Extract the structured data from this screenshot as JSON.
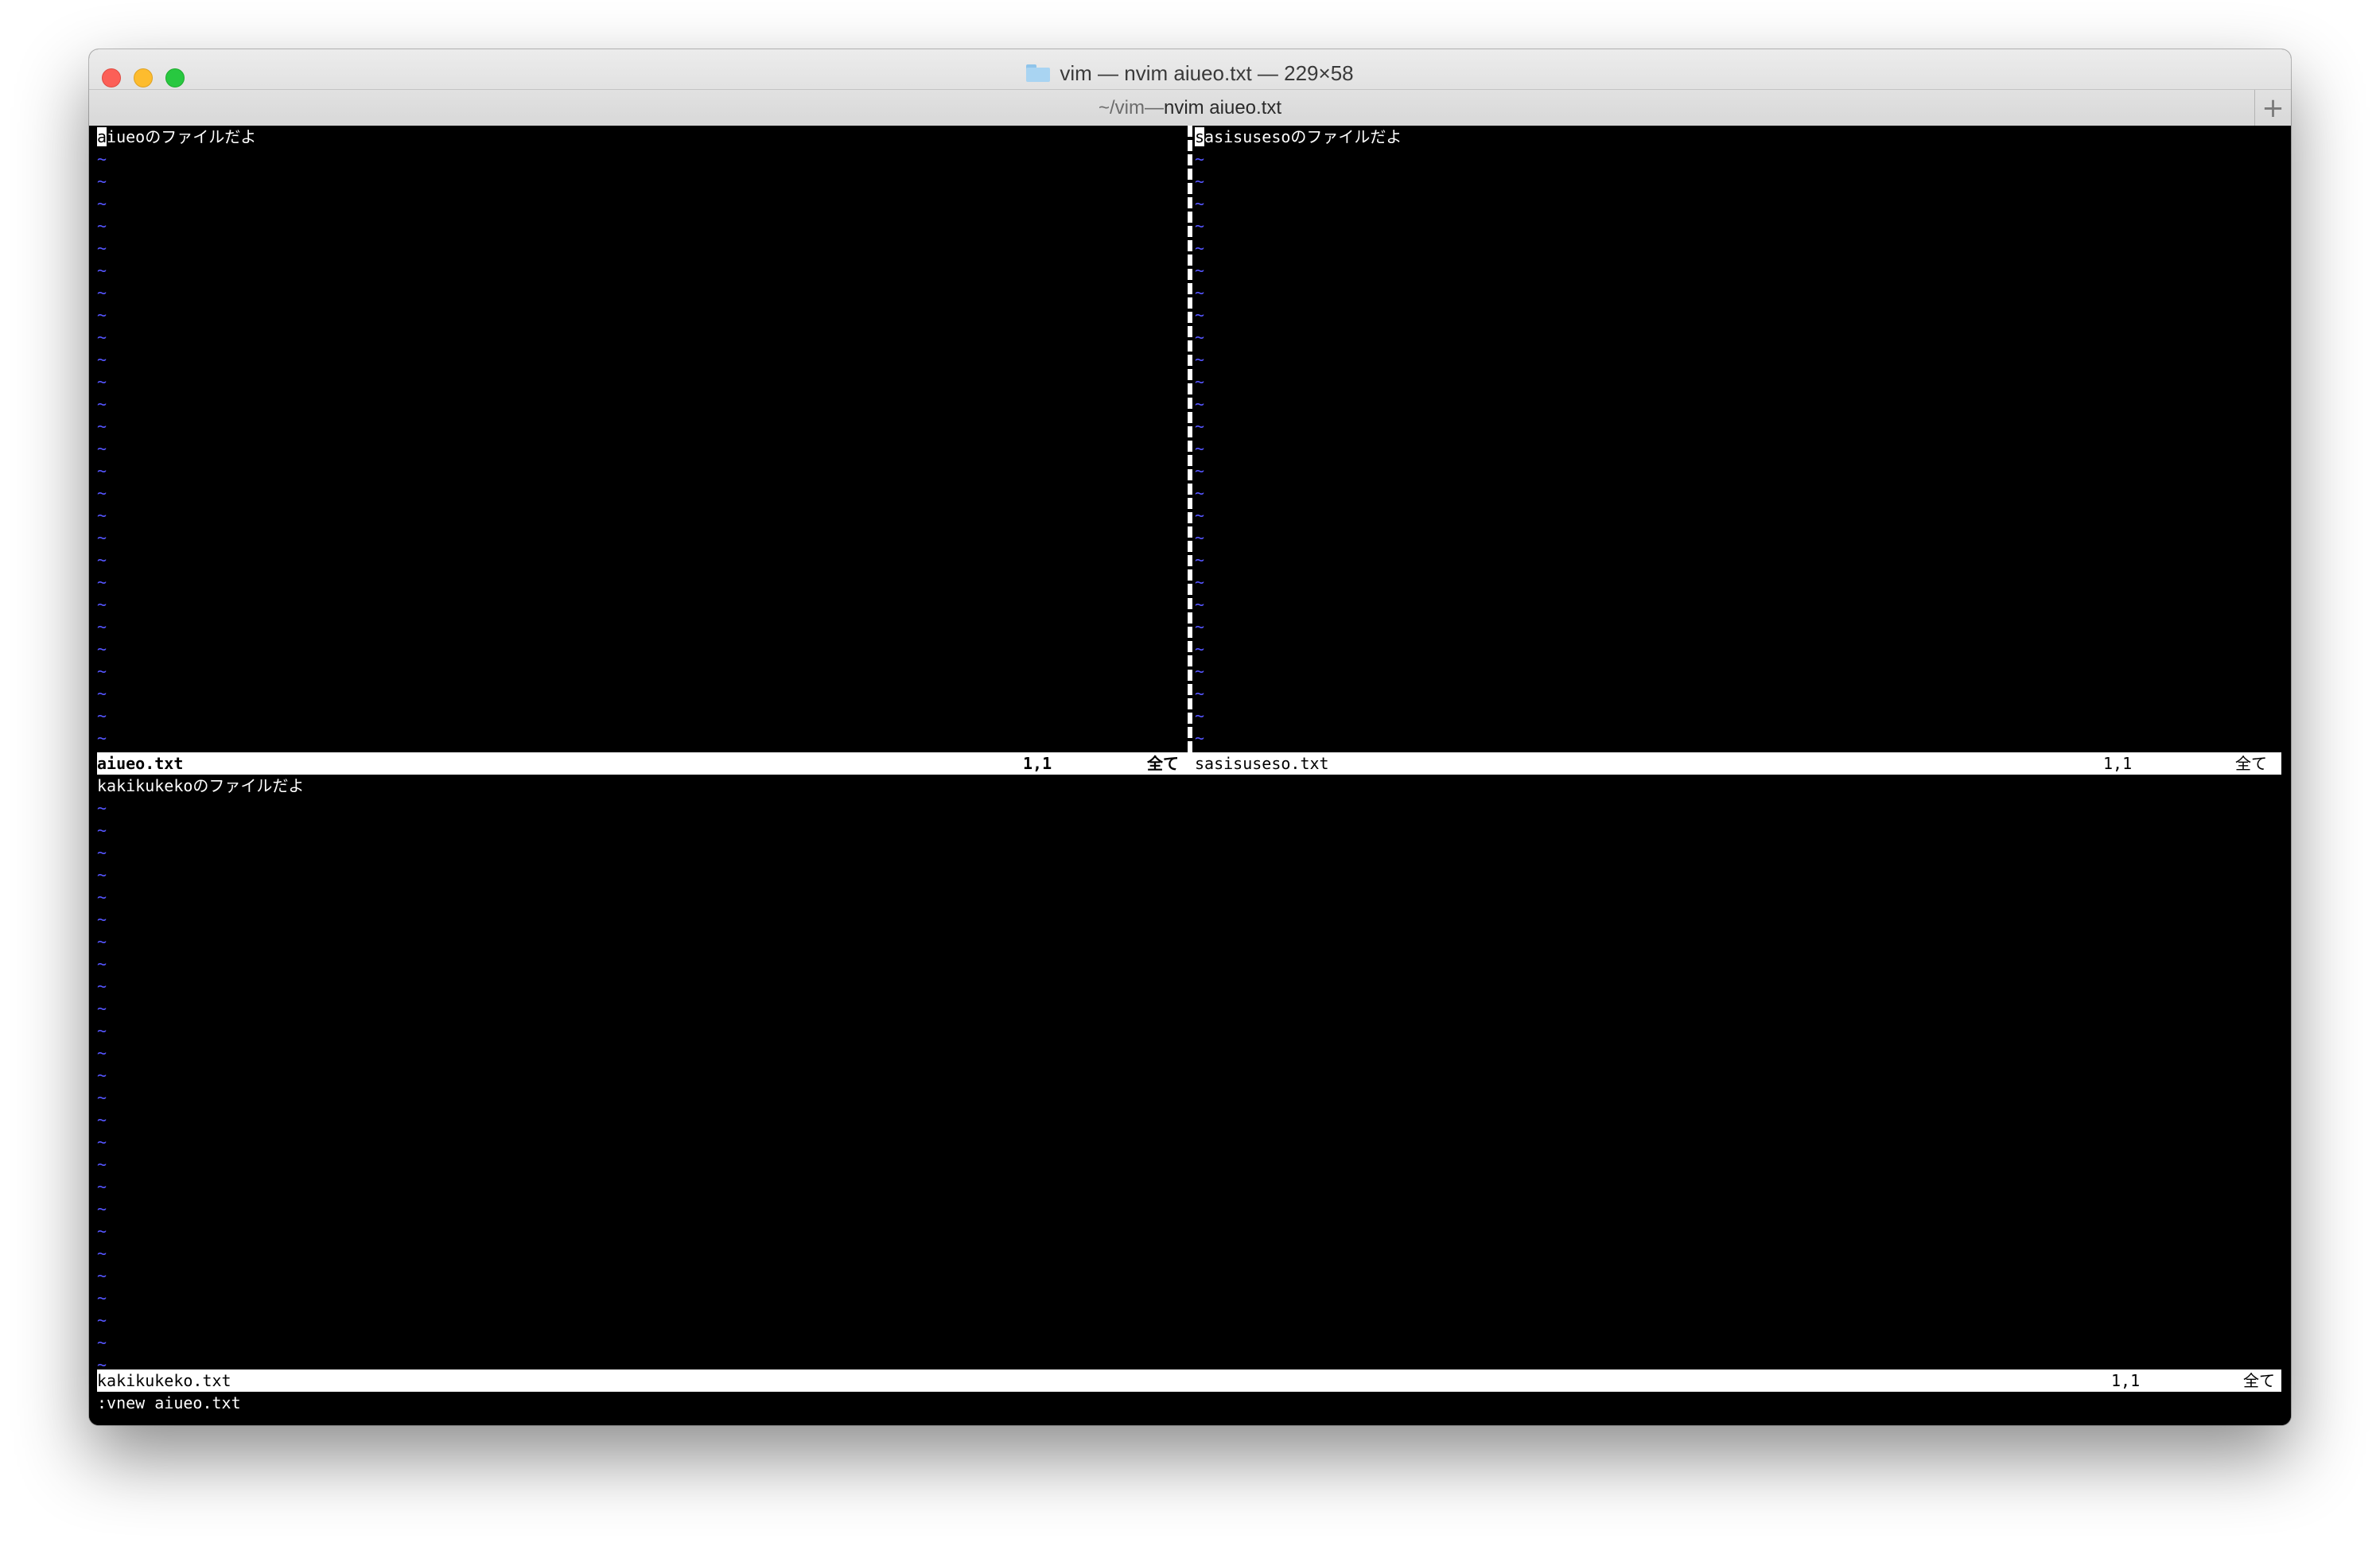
{
  "window": {
    "title": "vim — nvim aiueo.txt — 229×58",
    "tab": {
      "path": "~/vim",
      "separator": " — ",
      "command": "nvim aiueo.txt"
    },
    "new_tab_label": "+"
  },
  "icons": {
    "folder": "folder-icon",
    "close": "close-button",
    "minimize": "minimize-button",
    "maximize": "zoom-button",
    "new_tab": "plus-icon"
  },
  "colors": {
    "tilde": "#5555ff",
    "statusline_bg": "#ffffff",
    "terminal_bg": "#000000"
  },
  "tilde_char": "~",
  "panes": {
    "top_left": {
      "first_line_rest": "iueoのファイルだよ",
      "cursor_char": "a",
      "status": {
        "filename": "aiueo.txt",
        "position": "1,1",
        "scroll": "全て"
      }
    },
    "top_right": {
      "first_line_rest": "asisusesoのファイルだよ",
      "cursor_char": "s",
      "status": {
        "filename": "sasisuseso.txt",
        "position": "1,1",
        "scroll": "全て"
      }
    },
    "bottom": {
      "first_line": "kakikukekoのファイルだよ",
      "status": {
        "filename": "kakikukeko.txt",
        "position": "1,1",
        "scroll": "全て"
      }
    }
  },
  "cmdline": ":vnew aiueo.txt"
}
